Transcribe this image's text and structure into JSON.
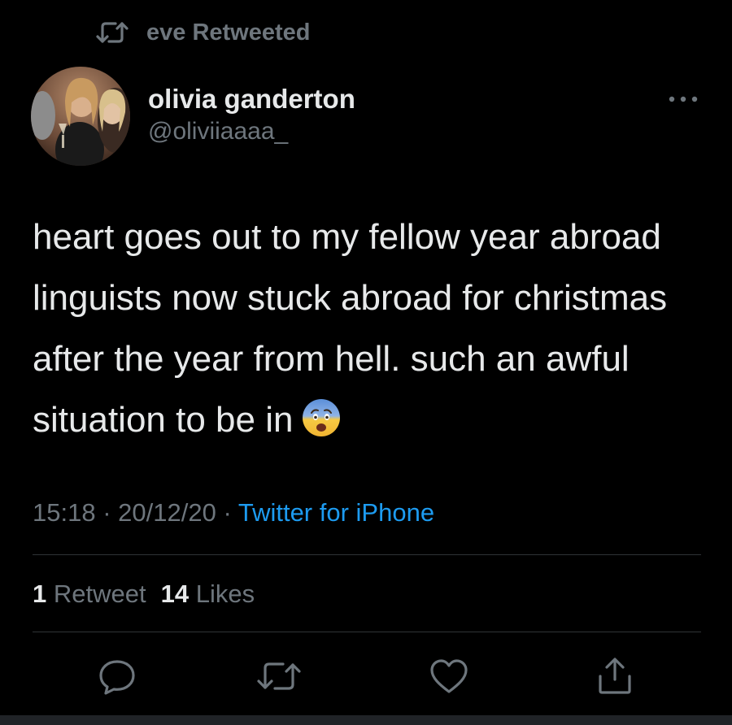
{
  "retweet_context": {
    "icon": "retweet-icon",
    "label": "eve Retweeted"
  },
  "tweet": {
    "author": {
      "name": "olivia ganderton",
      "handle": "@oliviiaaaa_",
      "avatar": "profile-photo"
    },
    "text": "heart goes out to my fellow year abroad linguists now stuck abroad for christmas after the year from hell. such an awful situation to be in",
    "emoji": "anxious-face-emoji",
    "time": "15:18",
    "separator": "·",
    "date": "20/12/20",
    "source": "Twitter for iPhone",
    "retweet_count": "1",
    "retweet_label": "Retweet",
    "like_count": "14",
    "like_label": "Likes"
  },
  "actions": [
    "reply-icon",
    "retweet-icon",
    "like-icon",
    "share-icon"
  ],
  "colors": {
    "background": "#000000",
    "text": "#e7e9ea",
    "secondary": "#6e767d",
    "link": "#1d9bf0",
    "divider": "#2f3336"
  }
}
